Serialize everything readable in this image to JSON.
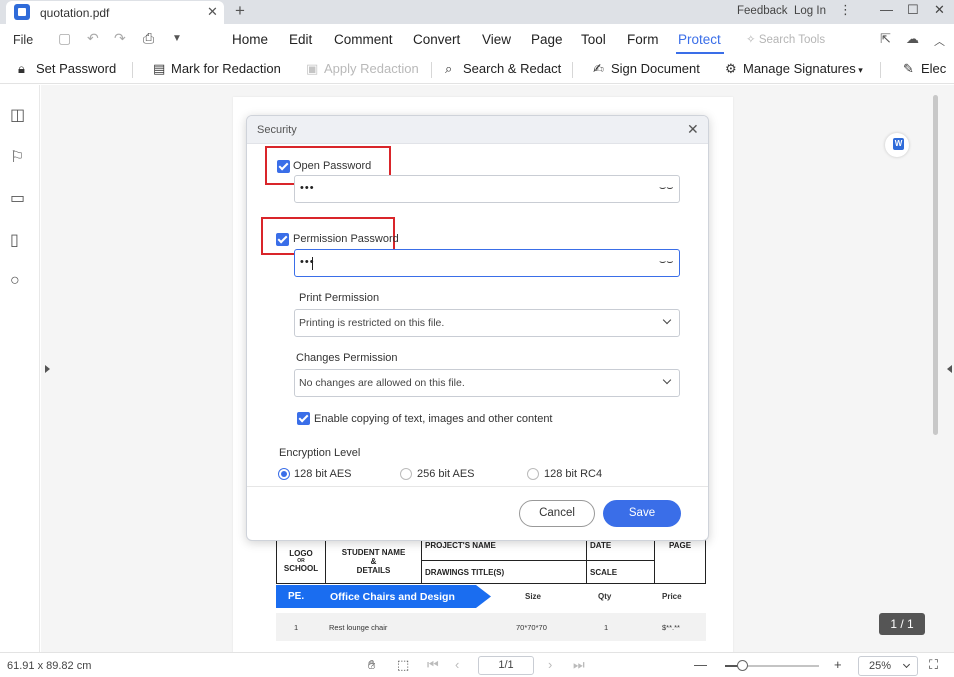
{
  "titlebar": {
    "tab_title": "quotation.pdf",
    "feedback": "Feedback",
    "login": "Log In"
  },
  "menu": {
    "file": "File",
    "items": [
      "Home",
      "Edit",
      "Comment",
      "Convert",
      "View",
      "Page",
      "Tool",
      "Form",
      "Protect"
    ],
    "active": "Protect",
    "search_placeholder": "Search Tools"
  },
  "toolbar": {
    "set_password": "Set Password",
    "mark_redaction": "Mark for Redaction",
    "apply_redaction": "Apply Redaction",
    "search_redact": "Search & Redact",
    "sign_document": "Sign Document",
    "manage_signatures": "Manage Signatures",
    "electronic": "Elec"
  },
  "dialog": {
    "title": "Security",
    "open_password": {
      "label": "Open Password",
      "checked": true,
      "value": "•••"
    },
    "permission_password": {
      "label": "Permission Password",
      "checked": true,
      "value": "•••"
    },
    "print_permission": {
      "label": "Print Permission",
      "value": "Printing is restricted on this file."
    },
    "changes_permission": {
      "label": "Changes Permission",
      "value": "No changes are allowed on this file."
    },
    "enable_copy": {
      "label": "Enable copying of text, images and other content",
      "checked": true
    },
    "encryption": {
      "label": "Encryption Level",
      "options": [
        "128 bit AES",
        "256 bit AES",
        "128 bit RC4"
      ],
      "selected": "128 bit AES"
    },
    "cancel": "Cancel",
    "save": "Save"
  },
  "document": {
    "header": {
      "logo": "LOGO",
      "logo_or": "OR",
      "school": "SCHOOL",
      "student_name": "STUDENT NAME",
      "amp": "&",
      "details": "DETAILS",
      "project_name": "PROJECT'S NAME",
      "date": "DATE",
      "page": "PAGE",
      "drawings_title": "DRAWINGS TITLE(S)",
      "scale": "SCALE"
    },
    "section": {
      "no": "PE.",
      "name": "Office Chairs and Design",
      "size": "Size",
      "qty": "Qty",
      "price": "Price"
    },
    "row": {
      "no": "1",
      "item": "Rest lounge chair",
      "size": "70*70*70",
      "qty": "1",
      "price": "$**.**"
    }
  },
  "page_badge": "1 / 1",
  "status": {
    "dimensions": "61.91 x 89.82 cm",
    "page": "1/1",
    "zoom": "25%",
    "zoom_fraction": 0.18
  }
}
